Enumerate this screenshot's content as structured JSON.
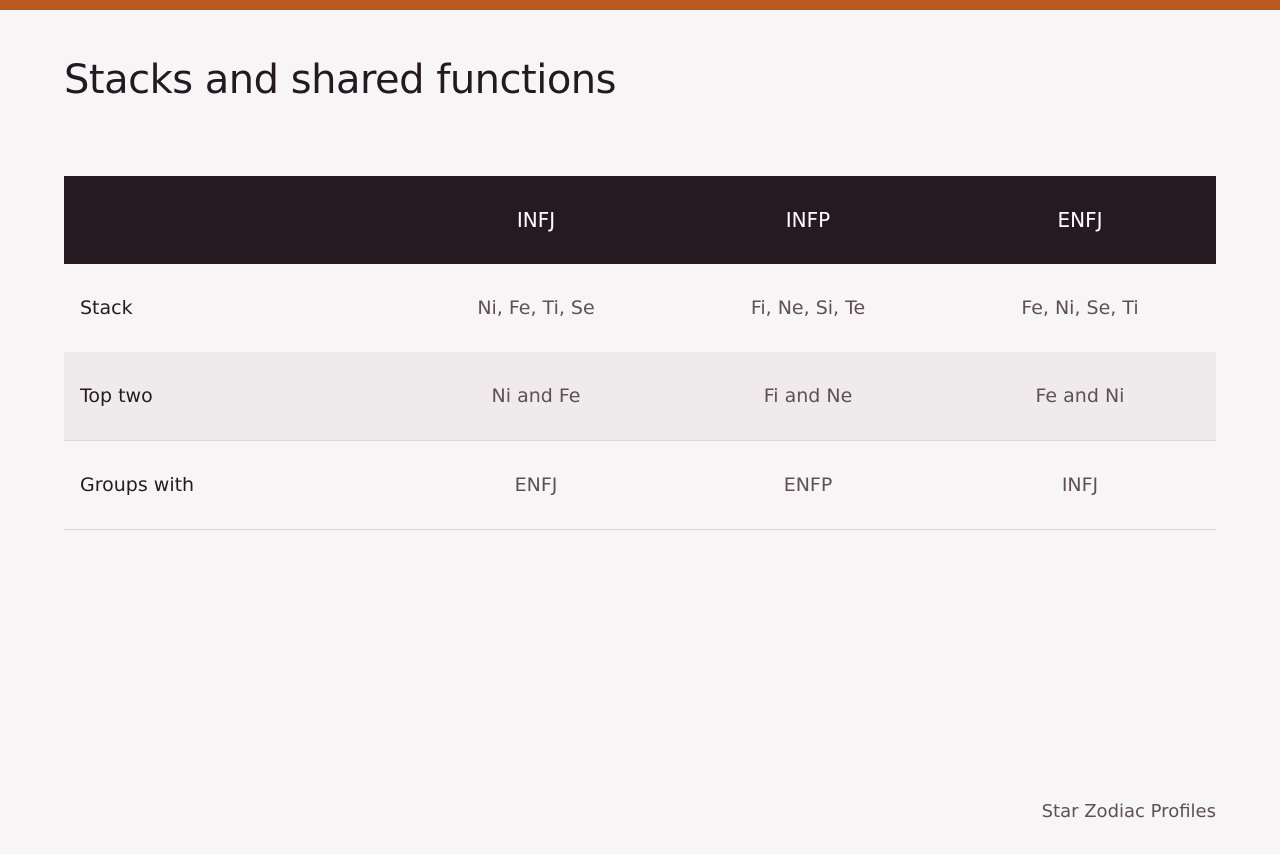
{
  "colors": {
    "accent_bar": "#b95a22",
    "header_background": "#251a1f",
    "page_background": "#f7f5f6",
    "striped_row": "#efebec"
  },
  "title": "Stacks and shared functions",
  "table": {
    "columns": [
      "",
      "INFJ",
      "INFP",
      "ENFJ"
    ],
    "rows": [
      {
        "label": "Stack",
        "cells": [
          "Ni, Fe, Ti, Se",
          "Fi, Ne, Si, Te",
          "Fe, Ni, Se, Ti"
        ]
      },
      {
        "label": "Top two",
        "cells": [
          "Ni and Fe",
          "Fi and Ne",
          "Fe and Ni"
        ]
      },
      {
        "label": "Groups with",
        "cells": [
          "ENFJ",
          "ENFP",
          "INFJ"
        ]
      }
    ]
  },
  "footer": {
    "credit": "Star Zodiac Profiles"
  }
}
